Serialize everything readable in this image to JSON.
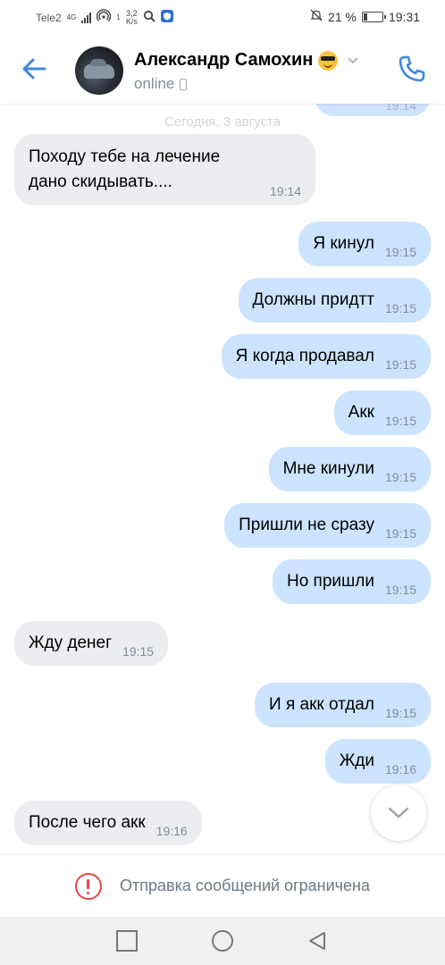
{
  "status_bar": {
    "carrier": "Tele2",
    "network": "4G",
    "hotspot_count": "1",
    "speed_value": "3,2",
    "speed_unit": "K/s",
    "battery": "21 %",
    "battery_level": 0.21,
    "time": "19:31"
  },
  "header": {
    "contact_name": "Александр Самохин",
    "status": "online"
  },
  "chat": {
    "partial_time": "19:14",
    "date_separator": "Сегодня, 3 августа",
    "messages": [
      {
        "direction": "in",
        "text": "Походу тебе на лечение дано скидывать....",
        "time": "19:14"
      },
      {
        "direction": "out",
        "text": "Я кинул",
        "time": "19:15"
      },
      {
        "direction": "out",
        "text": "Должны придтт",
        "time": "19:15"
      },
      {
        "direction": "out",
        "text": "Я когда продавал",
        "time": "19:15"
      },
      {
        "direction": "out",
        "text": "Акк",
        "time": "19:15"
      },
      {
        "direction": "out",
        "text": "Мне кинули",
        "time": "19:15"
      },
      {
        "direction": "out",
        "text": "Пришли не сразу",
        "time": "19:15"
      },
      {
        "direction": "out",
        "text": "Но пришли",
        "time": "19:15"
      },
      {
        "direction": "in",
        "text": "Жду денег",
        "time": "19:15"
      },
      {
        "direction": "out",
        "text": "И я акк отдал",
        "time": "19:15"
      },
      {
        "direction": "out",
        "text": "Жди",
        "time": "19:16"
      },
      {
        "direction": "in",
        "text": "После чего акк",
        "time": "19:16"
      }
    ]
  },
  "footer": {
    "restricted_text": "Отправка сообщений ограничена"
  },
  "colors": {
    "accent": "#3f8ae0",
    "incoming_bubble": "#ebedf0",
    "outgoing_bubble": "#cce4ff",
    "warning": "#e64646"
  }
}
